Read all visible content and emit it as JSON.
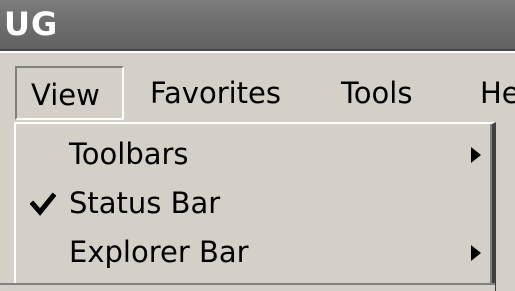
{
  "window": {
    "title_fragment": "UG"
  },
  "menubar": {
    "items": [
      {
        "label": "View",
        "active": true
      },
      {
        "label": "Favorites"
      },
      {
        "label": "Tools"
      },
      {
        "label": "He"
      }
    ]
  },
  "view_menu": {
    "items": [
      {
        "label": "Toolbars",
        "submenu": true,
        "checked": false,
        "icon": "submenu-arrow-icon"
      },
      {
        "label": "Status Bar",
        "submenu": false,
        "checked": true,
        "icon": "checkmark-icon"
      },
      {
        "label": "Explorer Bar",
        "submenu": true,
        "checked": false,
        "icon": "submenu-arrow-icon"
      }
    ]
  },
  "colors": {
    "face": "#d4d0c8",
    "titlebar": "#6e6e6e",
    "highlight": "#ffffff",
    "shadow": "#808080"
  }
}
